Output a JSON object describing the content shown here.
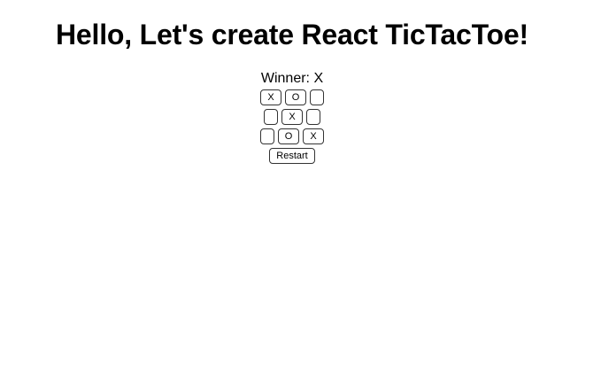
{
  "header": {
    "title": "Hello, Let's create React TicTacToe!"
  },
  "game": {
    "status": "Winner: X",
    "board": [
      [
        "X",
        "O",
        ""
      ],
      [
        "",
        "X",
        ""
      ],
      [
        "",
        "O",
        "X"
      ]
    ],
    "restart_label": "Restart"
  }
}
